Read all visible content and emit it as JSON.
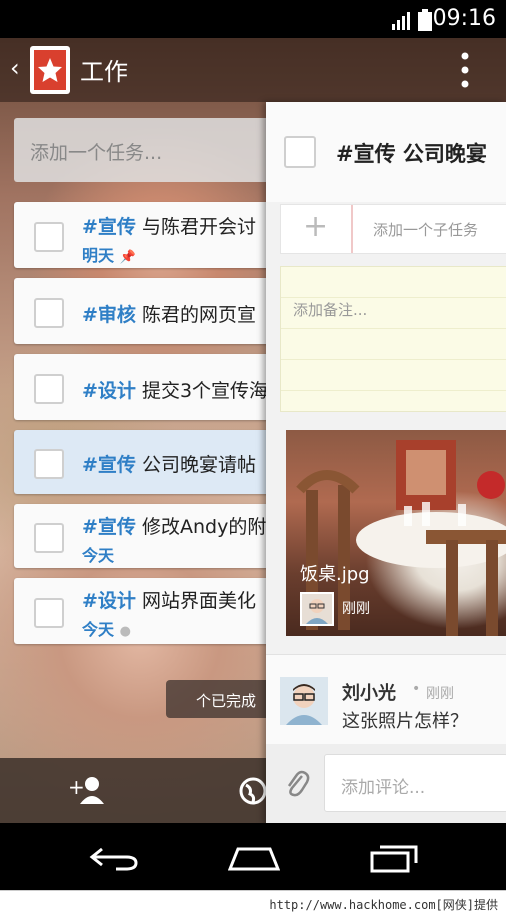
{
  "status": {
    "time": "09:16"
  },
  "header": {
    "title": "工作"
  },
  "add_task_placeholder": "添加一个任务...",
  "tasks": [
    {
      "tag": "#宣传",
      "text": "与陈君开会讨",
      "due": "明天",
      "selected": false
    },
    {
      "tag": "#审核",
      "text": "陈君的网页宣",
      "due": "",
      "selected": false
    },
    {
      "tag": "#设计",
      "text": "提交3个宣传海",
      "due": "",
      "selected": false
    },
    {
      "tag": "#宣传",
      "text": "公司晚宴请帖",
      "due": "",
      "selected": true
    },
    {
      "tag": "#宣传",
      "text": "修改Andy的附",
      "due": "今天",
      "selected": false
    },
    {
      "tag": "#设计",
      "text": "网站界面美化",
      "due": "今天",
      "selected": false
    }
  ],
  "completed_pill": "个已完成",
  "detail": {
    "title": "#宣传 公司晚宴",
    "add_subtask": "添加一个子任务",
    "add_note": "添加备注...",
    "attachment": {
      "filename": "饭桌.jpg",
      "time": "刚刚"
    },
    "comment": {
      "author": "刘小光",
      "time": "刚刚",
      "text": "这张照片怎样？"
    },
    "add_comment": "添加评论..."
  },
  "footer": "http://www.hackhome.com[网侠]提供",
  "colors": {
    "accent": "#2f7fc6",
    "logo": "#d9402e"
  }
}
